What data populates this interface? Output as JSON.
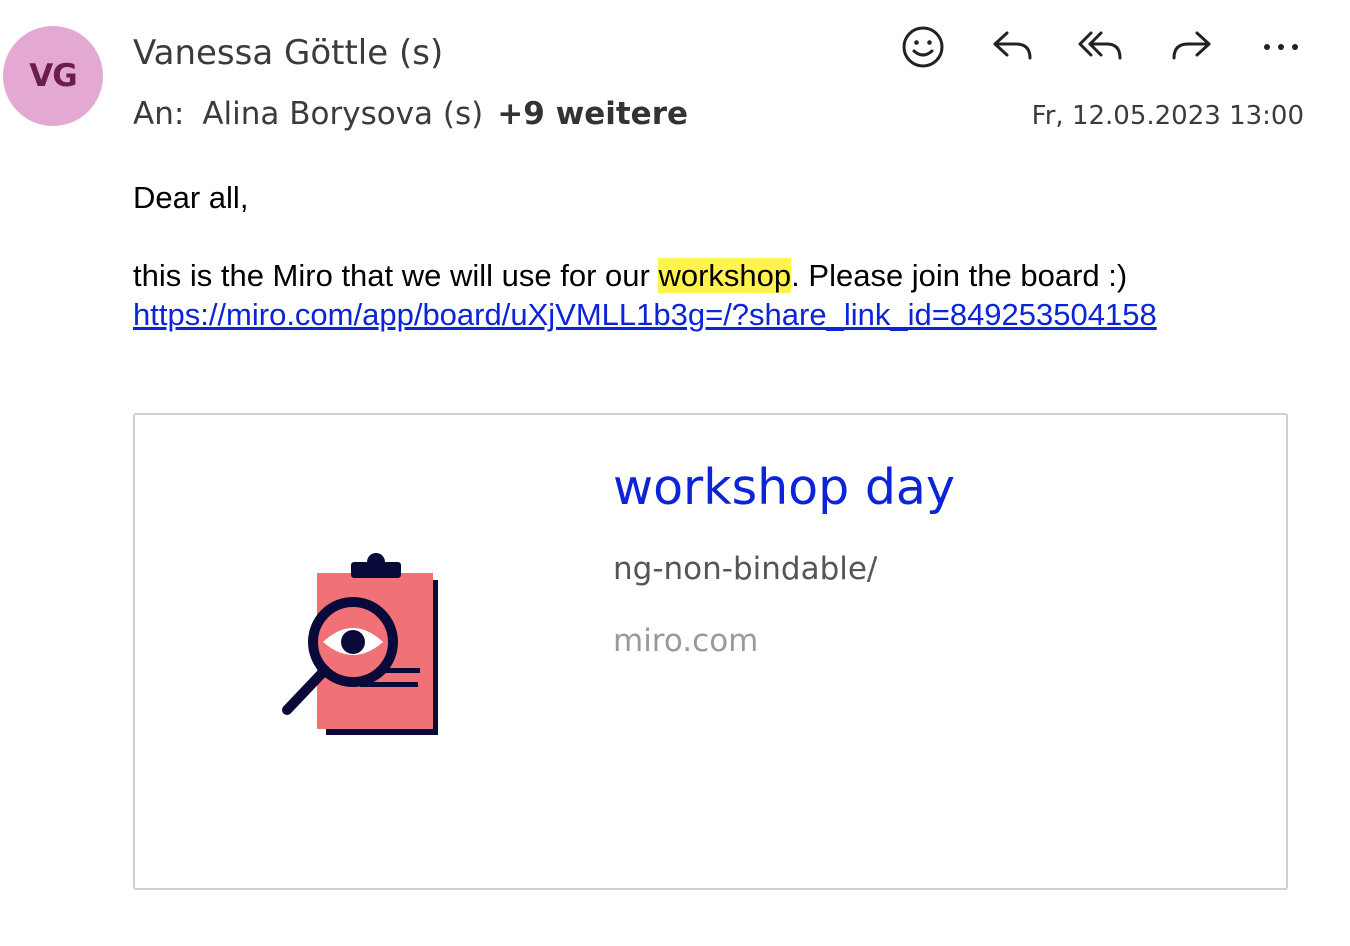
{
  "sender": {
    "initials": "VG",
    "name": "Vanessa Göttle (s)",
    "avatar_color": "#e3a9d3"
  },
  "recipients": {
    "label": "An:",
    "first": "Alina Borysova (s)",
    "more": "+9 weitere"
  },
  "date": "Fr, 12.05.2023 13:00",
  "actions": [
    {
      "icon": "emoji-smile-icon"
    },
    {
      "icon": "reply-icon"
    },
    {
      "icon": "reply-all-icon"
    },
    {
      "icon": "forward-icon"
    },
    {
      "icon": "more-icon"
    }
  ],
  "body": {
    "greeting": "Dear all,",
    "line_before": "this is the Miro that we will use for our ",
    "highlight": "workshop",
    "line_after": ". Please join the board :)",
    "link": "https://miro.com/app/board/uXjVMLL1b3g=/?share_link_id=849253504158"
  },
  "card": {
    "title": "workshop day",
    "description": "ng-non-bindable/",
    "domain": "miro.com",
    "thumbnail_icon": "clipboard-magnifier-icon"
  },
  "colors": {
    "link": "#0b24d8",
    "highlight": "#fff34d",
    "thumb_fill": "#f07277",
    "thumb_stroke": "#0a0a3a"
  }
}
